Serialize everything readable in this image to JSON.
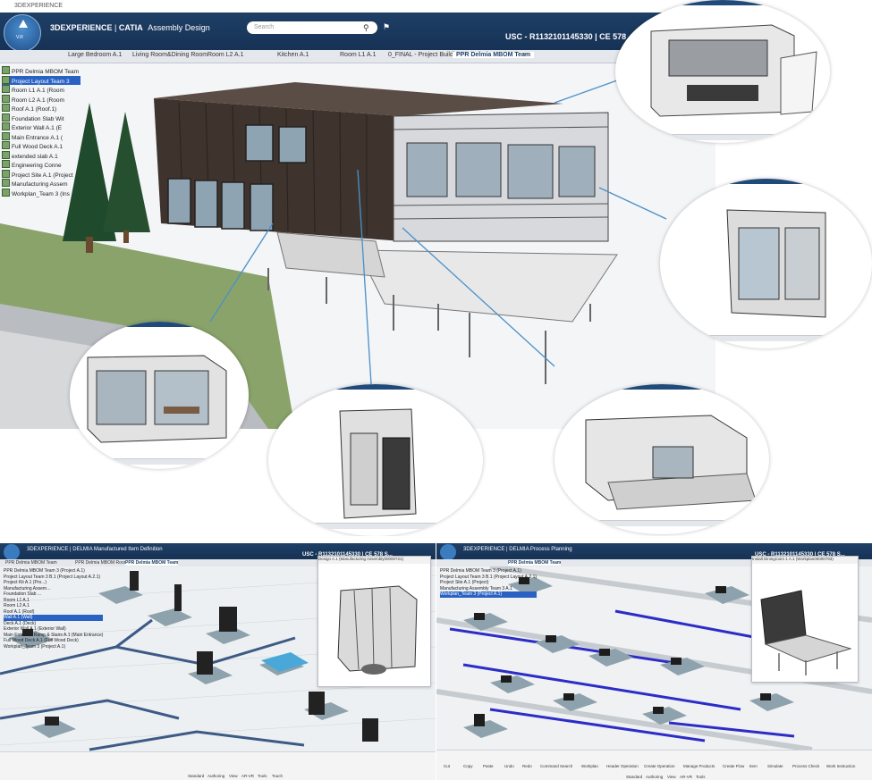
{
  "main": {
    "titlebar": "3DEXPERIENCE",
    "app_brand": "3DEXPERIENCE",
    "app_sep": " | ",
    "app_product": "CATIA",
    "app_module": "Assembly Design",
    "compass_label": "V.R",
    "search_placeholder": "Search",
    "user_id": "USC - R1132101145330 | CE 578",
    "tabs": [
      "Large Bedroom A.1",
      "Living Room&Dining Room",
      "Room L2 A.1",
      "Kitchen A.1",
      "Room L1 A.1",
      "0_FINAL - Project Building",
      "PPR Delmia MBOM Team"
    ],
    "active_tab": "PPR Delmia MBOM Team",
    "tree": [
      {
        "label": "PPR Delmia MBOM Team",
        "selected": false
      },
      {
        "label": "Project Layout Team 3",
        "selected": true
      },
      {
        "label": "Room L1 A.1 (Room",
        "selected": false
      },
      {
        "label": "Room L2 A.1 (Room",
        "selected": false
      },
      {
        "label": "Roof A.1 (Roof.1)",
        "selected": false
      },
      {
        "label": "Foundation Slab Wit",
        "selected": false
      },
      {
        "label": "Exterior Wall A.1 (E",
        "selected": false
      },
      {
        "label": "Main Entrance A.1 (",
        "selected": false
      },
      {
        "label": "Full Wood Deck A.1",
        "selected": false
      },
      {
        "label": "extended slab A.1",
        "selected": false
      },
      {
        "label": "Engineering Conne",
        "selected": false
      },
      {
        "label": "Project Site A.1 (Project",
        "selected": false
      },
      {
        "label": "Manufacturing Assem",
        "selected": false
      },
      {
        "label": "Workplan_Team 3 (Ins",
        "selected": false
      }
    ]
  },
  "panel_left": {
    "app_title": "3DEXPERIENCE | DELMIA Manufactured Item Definition",
    "user_id": "USC - R1132101145330 | CE 578 S...",
    "tabs": [
      "PPR Delmia MBOM Team",
      "PPR Delmia MBOM Room",
      "PPR Delmia MBOM Team"
    ],
    "tree": [
      {
        "label": "PPR Delmia MBOM Team 3 (Project A.1)",
        "selected": false
      },
      {
        "label": "Project Layout Team 3 B.1 (Project Layout A.2.1)",
        "selected": false
      },
      {
        "label": "Project Kit A.1 (Pro...)",
        "selected": false
      },
      {
        "label": "Manufacturing Assem...",
        "selected": false
      },
      {
        "label": "Foundation Slab ...",
        "selected": false
      },
      {
        "label": "Room L1 A.1",
        "selected": false
      },
      {
        "label": "Room L2 A.1",
        "selected": false
      },
      {
        "label": "Roof A.1 (Roof)",
        "selected": false
      },
      {
        "label": "Wall A.1 (Wall)",
        "selected": true
      },
      {
        "label": "Deck A.1 (Deck)",
        "selected": false
      },
      {
        "label": "Exterior Wall A.1 (Exterior Wall)",
        "selected": false
      },
      {
        "label": "Main Entrance Ramp & Stairs A.1 (Main Entrance)",
        "selected": false
      },
      {
        "label": "Full Wood Deck A.1 (Full Wood Deck)",
        "selected": false
      },
      {
        "label": "Workplan_Team 3 (Project A.1)",
        "selected": false
      }
    ],
    "inset_title": "Design A.1 (Manufacturing Assembly00000721)",
    "bottom_tabs": [
      "Standard",
      "Authoring",
      "View",
      "AR-VR",
      "Tools",
      "Touch"
    ]
  },
  "panel_right": {
    "app_title": "3DEXPERIENCE | DELMIA Process Planning",
    "user_id": "USC - R1132101145330 | CE 578 S...",
    "tabs": [
      "PPR Delmia MBOM Team"
    ],
    "tree": [
      {
        "label": "PPR Delmia MBOM Team 3 (Project A.1)",
        "selected": false
      },
      {
        "label": "Project Layout Team 3 B.1 (Project Layout A.2.1)",
        "selected": false
      },
      {
        "label": "Project Site A.1 (Project)",
        "selected": false
      },
      {
        "label": "Manufacturing Assembly Team 3 A.1",
        "selected": false
      },
      {
        "label": "Workplan_Team 3 (Project A.1)",
        "selected": true
      }
    ],
    "inset_title": "Install Diningroom 1 A.1 (Workplan00000793)",
    "bottom_tabs": [
      "Standard",
      "Authoring",
      "View",
      "AR-VR",
      "Tools"
    ],
    "toolbar": [
      "Cut",
      "Copy",
      "Paste",
      "Undo",
      "Redo",
      "Command Search",
      "Workplan",
      "Header Operation",
      "Create Operation",
      "Create Instruction",
      "Manage Products",
      "Assigned Products",
      "System Information",
      "Create Flow",
      "Create Precedence",
      "Set Sequence",
      "Item",
      "Simulate",
      "Process Check",
      "Workload Balancing",
      "Precedence Graph",
      "Work Instruction"
    ]
  },
  "colors": {
    "accent": "#1f3f66",
    "selected": "#2a62c4",
    "flow_line": "#2c2cc7",
    "leader": "#4a90c8"
  }
}
